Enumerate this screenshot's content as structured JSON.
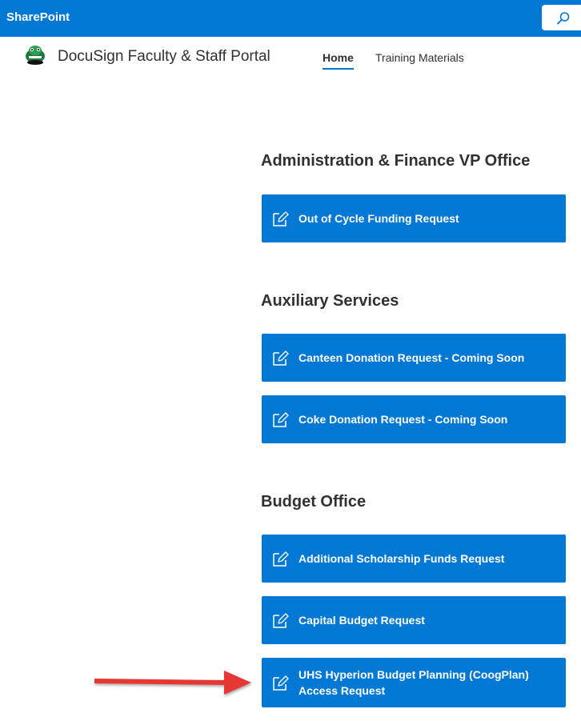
{
  "suite_bar": {
    "title": "SharePoint"
  },
  "site": {
    "title": "DocuSign Faculty & Staff Portal",
    "nav": [
      {
        "label": "Home",
        "selected": true
      },
      {
        "label": "Training Materials",
        "selected": false
      }
    ]
  },
  "sections": [
    {
      "heading": "Administration & Finance VP Office",
      "buttons": [
        {
          "label": "Out of Cycle Funding Request",
          "icon": "edit-form-icon"
        }
      ]
    },
    {
      "heading": "Auxiliary Services",
      "buttons": [
        {
          "label": "Canteen Donation Request - Coming Soon",
          "icon": "edit-form-icon"
        },
        {
          "label": "Coke Donation Request - Coming Soon",
          "icon": "edit-form-icon"
        }
      ]
    },
    {
      "heading": "Budget Office",
      "buttons": [
        {
          "label": "Additional Scholarship Funds Request",
          "icon": "edit-form-icon"
        },
        {
          "label": "Capital Budget Request",
          "icon": "edit-form-icon"
        },
        {
          "label": "UHS Hyperion Budget Planning (CoogPlan) Access Request",
          "icon": "edit-form-icon"
        }
      ]
    }
  ],
  "colors": {
    "suite_bar": "#0078d4",
    "button_bg": "#0078d4",
    "annotation_arrow": "#e53935"
  }
}
